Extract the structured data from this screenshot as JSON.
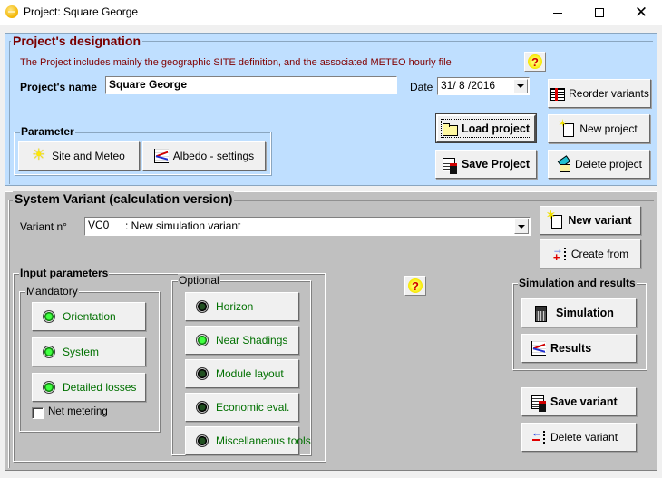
{
  "window": {
    "title": "Project:  Square George",
    "controls": {
      "minimize": "minimize",
      "maximize": "maximize",
      "close": "close"
    }
  },
  "project": {
    "legend": "Project's designation",
    "description": "The Project includes mainly the geographic SITE definition, and the associated  METEO  hourly file",
    "name_label": "Project's name",
    "name_value": "Square George",
    "date_label": "Date",
    "date_value": "31/ 8 /2016",
    "help_label": "?",
    "parameter": {
      "legend": "Parameter",
      "site_meteo_label": "Site and Meteo",
      "albedo_label": "Albedo - settings"
    },
    "buttons": {
      "reorder_variants": "Reorder variants",
      "load_project": "Load project",
      "new_project": "New project",
      "save_project": "Save Project",
      "delete_project": "Delete project"
    }
  },
  "variant": {
    "legend": "System Variant (calculation version)",
    "variant_label": "Variant n°",
    "variant_code": "VC0",
    "variant_value": ": New simulation variant",
    "new_variant": "New variant",
    "create_from": "Create from",
    "help_label": "?",
    "input_parameters": {
      "legend": "Input parameters",
      "mandatory": {
        "legend": "Mandatory",
        "items": [
          {
            "label": "Orientation",
            "status": "ok"
          },
          {
            "label": "System",
            "status": "ok"
          },
          {
            "label": "Detailed losses",
            "status": "ok"
          }
        ],
        "net_metering_label": "Net metering",
        "net_metering_checked": false
      },
      "optional": {
        "legend": "Optional",
        "items": [
          {
            "label": "Horizon",
            "status": "off"
          },
          {
            "label": "Near Shadings",
            "status": "ok"
          },
          {
            "label": "Module layout",
            "status": "off"
          },
          {
            "label": "Economic eval.",
            "status": "off"
          },
          {
            "label": "Miscellaneous tools",
            "status": "off"
          }
        ]
      }
    },
    "simulation": {
      "legend": "Simulation and results",
      "simulation_label": "Simulation",
      "results_label": "Results"
    },
    "save_variant": "Save variant",
    "delete_variant": "Delete variant"
  },
  "colors": {
    "project_bg": "#bfdfff",
    "variant_bg": "#c0c0c0",
    "heading_red": "#7a0000",
    "option_green": "#007000"
  }
}
